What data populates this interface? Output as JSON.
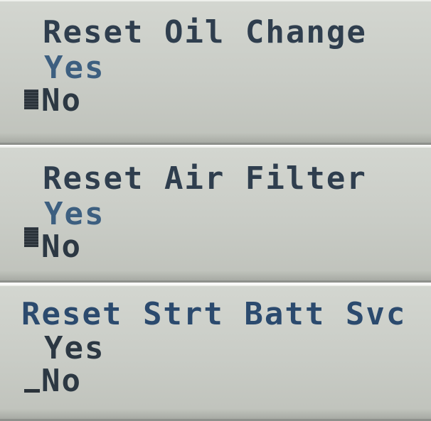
{
  "screens": [
    {
      "title": "Reset Oil Change",
      "options": [
        "Yes",
        "No"
      ],
      "selected": "No",
      "cursor": "block"
    },
    {
      "title": "Reset Air Filter",
      "options": [
        "Yes",
        "No"
      ],
      "selected": "No",
      "cursor": "block"
    },
    {
      "title": "Reset Strt Batt Svc",
      "options": [
        "Yes",
        "No"
      ],
      "selected": "No",
      "cursor": "underline"
    }
  ],
  "colors": {
    "lcd_background": "#c9ccc6",
    "text_dark": "#2c3843",
    "text_blue": "#3d5f80"
  }
}
